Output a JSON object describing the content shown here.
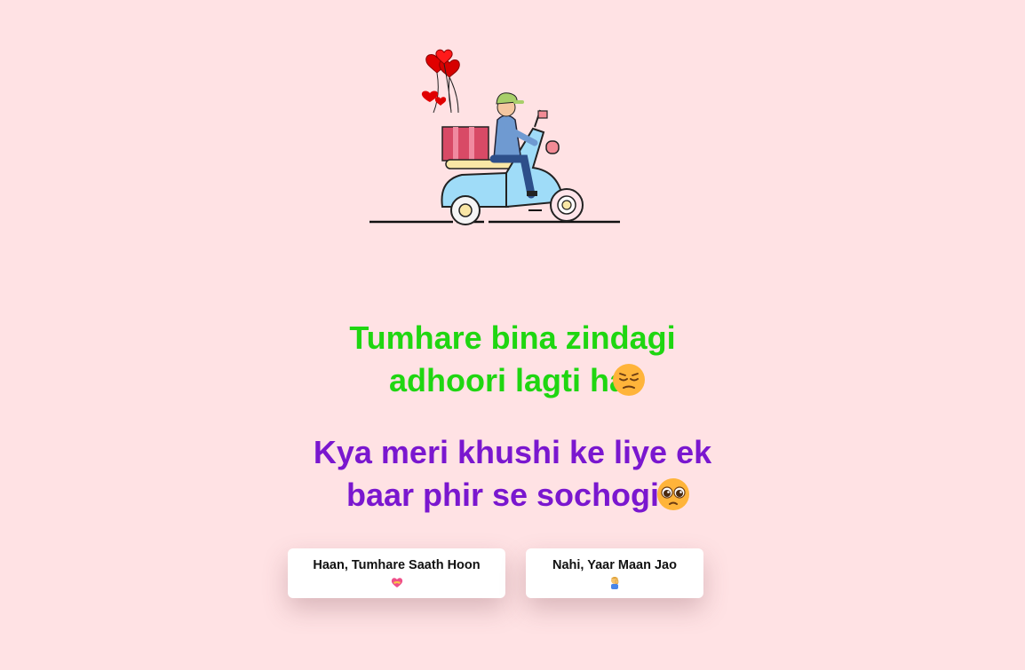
{
  "messages": {
    "line1": "Tumhare bina zindagi adhoori lagti hai",
    "line1_emoji": "pensive-face-emoji",
    "line2": "Kya meri khushi ke liye ek baar phir se sochogi?",
    "line2_emoji": "pleading-face-emoji"
  },
  "buttons": {
    "yes_label": "Haan, Tumhare Saath Hoon",
    "yes_icon": "heart-with-ribbon-icon",
    "no_label": "Nahi, Yaar Maan Jao",
    "no_icon": "person-facepalming-icon"
  },
  "colors": {
    "background": "#ffe2e4",
    "line1": "#1fd611",
    "line2": "#7a17cf",
    "button_bg": "#ffffff"
  },
  "illustration": {
    "name": "scooter-delivery-with-heart-balloons"
  }
}
